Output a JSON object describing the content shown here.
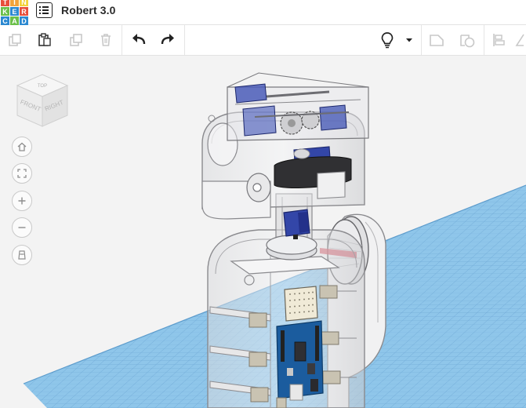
{
  "app": {
    "logo_letters": [
      "T",
      "I",
      "N",
      "K",
      "E",
      "R",
      "C",
      "A",
      "D"
    ],
    "logo_colors": [
      "#e84e3b",
      "#f3a33b",
      "#f3d23b",
      "#6bbf4a",
      "#2c89d1",
      "#e84e3b",
      "#2c89d1",
      "#6bbf4a",
      "#2c89d1"
    ],
    "document_title": "Robert 3.0"
  },
  "toolbar": {
    "left_tools": [
      "copy-icon",
      "paste-icon",
      "duplicate-icon",
      "trash-icon",
      "undo-icon",
      "redo-icon"
    ],
    "right_tools": [
      "lightbulb-icon",
      "dropdown-caret-icon",
      "solid-shape-icon",
      "hole-shape-icon",
      "align-icon",
      "mirror-icon"
    ]
  },
  "view_cube": {
    "front_label": "FRONT",
    "right_label": "RIGHT",
    "top_label": "TOP"
  },
  "nav_controls": [
    "home-view",
    "fit-all",
    "zoom-in",
    "zoom-out",
    "perspective"
  ],
  "colors": {
    "accent_blue": "#2a7fc9",
    "workplane_blue": "#8fc6ea",
    "arduino_blue": "#1b5c9e",
    "servo_blue": "#3346a8"
  }
}
